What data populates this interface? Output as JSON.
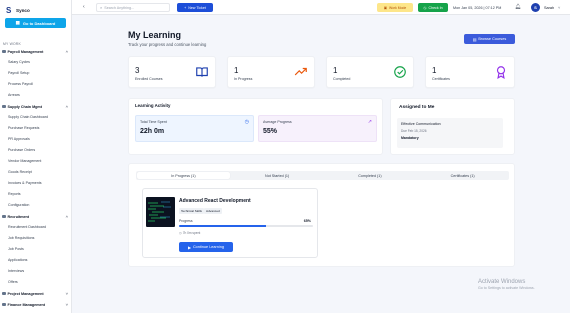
{
  "brand": {
    "name": "Synco"
  },
  "sidebar": {
    "dashboard_button": "Go to Dashboard",
    "section_title": "MY WORK",
    "groups": [
      {
        "label": "Payroll Management",
        "items": [
          "Salary Cycles",
          "Payroll Setup",
          "Process Payroll",
          "Arrears"
        ]
      },
      {
        "label": "Supply Chain Mgmt",
        "items": [
          "Supply Chain Dashboard",
          "Purchase Requests",
          "PR Approvals",
          "Purchase Orders",
          "Vendor Management",
          "Goods Receipt",
          "Invoices & Payments",
          "Reports",
          "Configuration"
        ]
      },
      {
        "label": "Recruitment",
        "items": [
          "Recruitment Dashboard",
          "Job Requisitions",
          "Job Posts",
          "Applications",
          "Interviews",
          "Offers"
        ]
      },
      {
        "label": "Project Management",
        "items": []
      },
      {
        "label": "Finance Management",
        "items": []
      }
    ]
  },
  "topbar": {
    "search_placeholder": "Search Anything...",
    "new_ticket": "New Ticket",
    "work_mode": "Work Mode",
    "check_in": "Check In",
    "datetime": "Mon Jan 05, 2026 | 07:12 PM",
    "avatar_initial": "S",
    "user_name": "Sarah"
  },
  "page": {
    "title": "My Learning",
    "subtitle": "Track your progress and continue learning",
    "browse_button": "Browse Courses"
  },
  "stats": [
    {
      "value": "3",
      "label": "Enrolled Courses",
      "icon": "book-icon",
      "color": "#1e40af"
    },
    {
      "value": "1",
      "label": "In Progress",
      "icon": "trending-up-icon",
      "color": "#ea580c"
    },
    {
      "value": "1",
      "label": "Completed",
      "icon": "check-circle-icon",
      "color": "#16a34a"
    },
    {
      "value": "1",
      "label": "Certificates",
      "icon": "award-icon",
      "color": "#9333ea"
    }
  ],
  "activity": {
    "title": "Learning Activity",
    "time_label": "Total Time Spent",
    "time_value": "22h 0m",
    "avg_label": "Average Progress",
    "avg_value": "55%"
  },
  "assigned": {
    "title": "Assigned to Me",
    "item_title": "Effective Communication",
    "item_due": "Due Feb 15, 2026",
    "item_badge": "Mandatory"
  },
  "tabs": [
    "In Progress (1)",
    "Not Started (1)",
    "Completed (1)",
    "Certificates (1)"
  ],
  "course": {
    "title": "Advanced React Development",
    "tags": [
      "Technical Skills",
      "Advanced"
    ],
    "progress_label": "Progress",
    "progress_value": "65%",
    "progress": 0.65,
    "time_spent": "7h 0m spent",
    "continue_button": "Continue Learning"
  },
  "watermark": {
    "line1": "Activate Windows",
    "line2": "Go to Settings to activate Windows."
  }
}
